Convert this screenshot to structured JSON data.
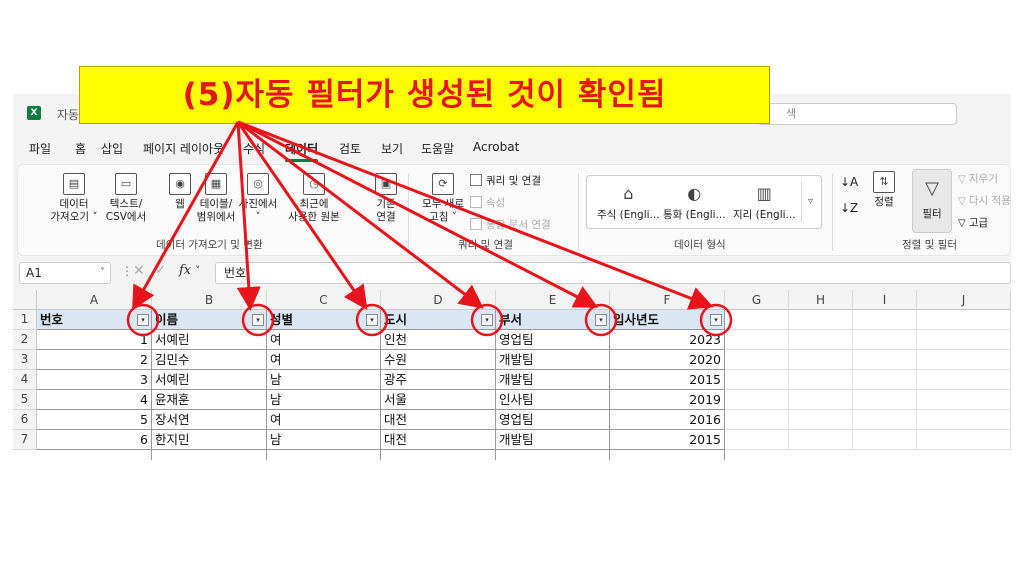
{
  "annotation": {
    "text": "(5)자동 필터가 생성된 것이 확인됨",
    "text_color": "#e8141b",
    "background": "#ffff00"
  },
  "window": {
    "app_icon": "excel-icon",
    "app_letter": "X",
    "title_partial": "자동",
    "search_partial": "색"
  },
  "menu": [
    {
      "label": "파일"
    },
    {
      "label": "홈"
    },
    {
      "label": "삽입"
    },
    {
      "label": "페이지 레이아웃"
    },
    {
      "label": "수식"
    },
    {
      "label": "데이터",
      "active": true
    },
    {
      "label": "검토"
    },
    {
      "label": "보기"
    },
    {
      "label": "도움말"
    },
    {
      "label": "Acrobat"
    }
  ],
  "ribbon": {
    "get_data": {
      "buttons": [
        {
          "label1": "데이터",
          "label2": "가져오기 ˅",
          "icon": "database-icon"
        },
        {
          "label1": "텍스트/",
          "label2": "CSV에서",
          "icon": "text-file-icon"
        },
        {
          "label1": "웹",
          "label2": "",
          "icon": "web-icon"
        },
        {
          "label1": "테이블/",
          "label2": "범위에서",
          "icon": "table-icon"
        },
        {
          "label1": "사진에서",
          "label2": "˅",
          "icon": "camera-icon"
        },
        {
          "label1": "최근에",
          "label2": "사용한 원본",
          "icon": "clock-icon"
        },
        {
          "label1": "기존",
          "label2": "연결",
          "icon": "existing-connection-icon"
        }
      ],
      "group_label": "데이터 가져오기 및 변환"
    },
    "queries": {
      "refresh_label1": "모두 새로",
      "refresh_label2": "고침 ˅",
      "items": [
        {
          "label": "쿼리 및 연결",
          "enabled": true
        },
        {
          "label": "속성",
          "enabled": false
        },
        {
          "label": "통합 문서 연결",
          "enabled": false
        }
      ],
      "group_label": "쿼리 및 연결"
    },
    "data_types": {
      "items": [
        {
          "label": "주식 (Engli...",
          "icon": "bank-icon"
        },
        {
          "label": "통화 (Engli...",
          "icon": "currency-icon"
        },
        {
          "label": "지리 (Engli...",
          "icon": "map-icon"
        }
      ],
      "more": "▿",
      "group_label": "데이터 형식"
    },
    "sort_filter": {
      "sort_az_icon": "sort-ascending-icon",
      "sort_za_icon": "sort-descending-icon",
      "sort_label": "정렬",
      "filter_label": "필터",
      "side_items": [
        {
          "label": "지우기",
          "enabled": false
        },
        {
          "label": "다시 적용",
          "enabled": false
        },
        {
          "label": "고급",
          "enabled": true
        }
      ],
      "group_label": "정렬 및 필터"
    }
  },
  "formula_bar": {
    "name_box": "A1",
    "name_box_arrow": "˅",
    "separator": "⋮",
    "cancel": "✕",
    "confirm": "✓",
    "fx": "fx",
    "fx_arrow": "˅",
    "content": "번호"
  },
  "sheet": {
    "columns": [
      "A",
      "B",
      "C",
      "D",
      "E",
      "F",
      "G",
      "H",
      "I",
      "J"
    ],
    "rows": [
      "1",
      "2",
      "3",
      "4",
      "5",
      "6",
      "7"
    ],
    "filter_dropdown_glyph": "▾",
    "headers": [
      "번호",
      "이름",
      "성별",
      "도시",
      "부서",
      "입사년도"
    ],
    "data": [
      [
        "1",
        "서예린",
        "여",
        "인천",
        "영업팀",
        "2023"
      ],
      [
        "2",
        "김민수",
        "여",
        "수원",
        "개발팀",
        "2020"
      ],
      [
        "3",
        "서예린",
        "남",
        "광주",
        "개발팀",
        "2015"
      ],
      [
        "4",
        "윤재훈",
        "남",
        "서울",
        "인사팀",
        "2019"
      ],
      [
        "5",
        "장서연",
        "여",
        "대전",
        "영업팀",
        "2016"
      ],
      [
        "6",
        "한지민",
        "남",
        "대전",
        "개발팀",
        "2015"
      ]
    ],
    "header_fill": "#dbe6f4"
  },
  "highlight_color": "#e8141b"
}
